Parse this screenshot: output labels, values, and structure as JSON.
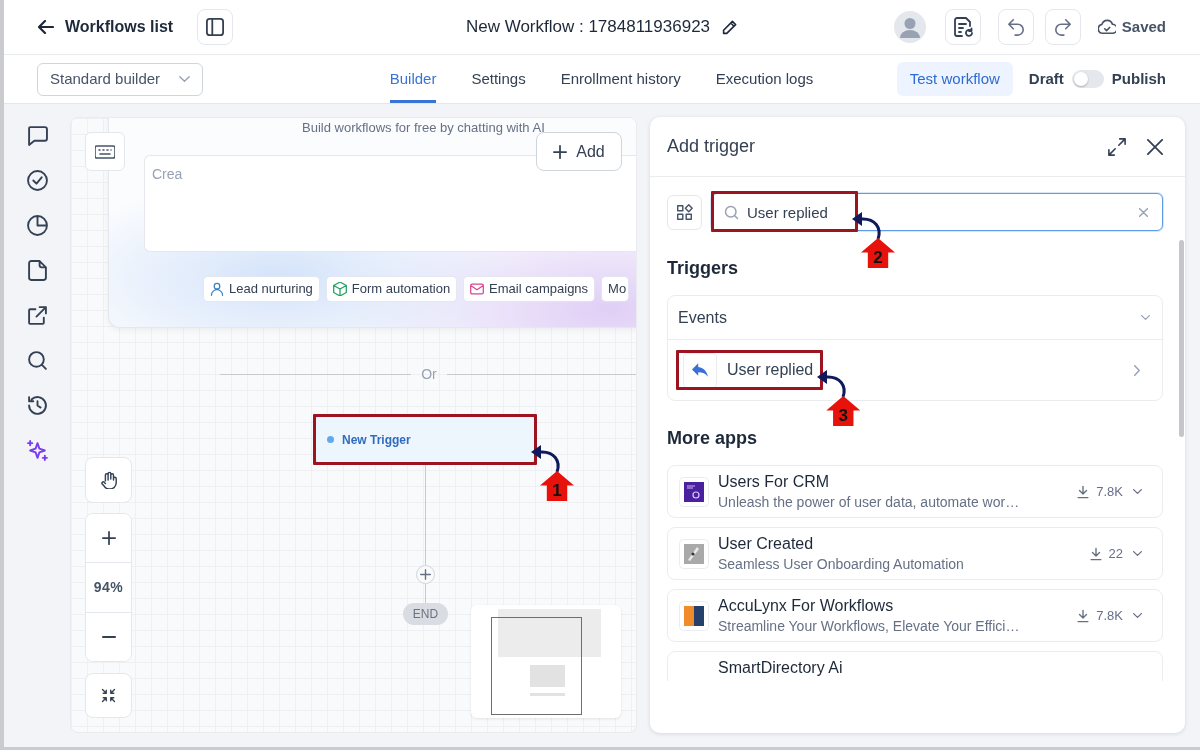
{
  "header": {
    "back_link": "Workflows list",
    "title": "New Workflow : 1784811936923",
    "save_status": "Saved"
  },
  "toolbar": {
    "builder_select": "Standard builder",
    "tabs": [
      {
        "label": "Builder",
        "selected": true
      },
      {
        "label": "Settings",
        "selected": false
      },
      {
        "label": "Enrollment history",
        "selected": false
      },
      {
        "label": "Execution logs",
        "selected": false
      }
    ],
    "test_button": "Test workflow",
    "publish_toggle": {
      "off_label": "Draft",
      "on_label": "Publish",
      "on": false
    }
  },
  "canvas": {
    "ai_prompt": {
      "subtitle": "Build workflows for free by chatting with AI",
      "placeholder": "Crea",
      "add_button": "Add",
      "suggestions": [
        "Lead nurturing",
        "Form automation",
        "Email campaigns",
        "Mo"
      ]
    },
    "divider": "Or",
    "trigger_node": {
      "label": "New Trigger",
      "callout": "1"
    },
    "end_label": "END",
    "zoom": "94%"
  },
  "panel": {
    "title": "Add trigger",
    "search": {
      "value": "User replied",
      "focused": true,
      "callout": "2"
    },
    "triggers": {
      "heading": "Triggers",
      "group": {
        "title": "Events",
        "expanded": true,
        "items": [
          {
            "label": "User replied",
            "callout": "3"
          }
        ]
      }
    },
    "more_apps": {
      "heading": "More apps",
      "apps": [
        {
          "name": "Users For CRM",
          "description": "Unleash the power of user data, automate wor…",
          "installs": "7.8K"
        },
        {
          "name": "User Created",
          "description": "Seamless User Onboarding Automation",
          "installs": "22"
        },
        {
          "name": "AccuLynx For Workflows",
          "description": "Streamline Your Workflows, Elevate Your Effici…",
          "installs": "7.8K"
        },
        {
          "name": "SmartDirectory Ai"
        }
      ]
    }
  }
}
